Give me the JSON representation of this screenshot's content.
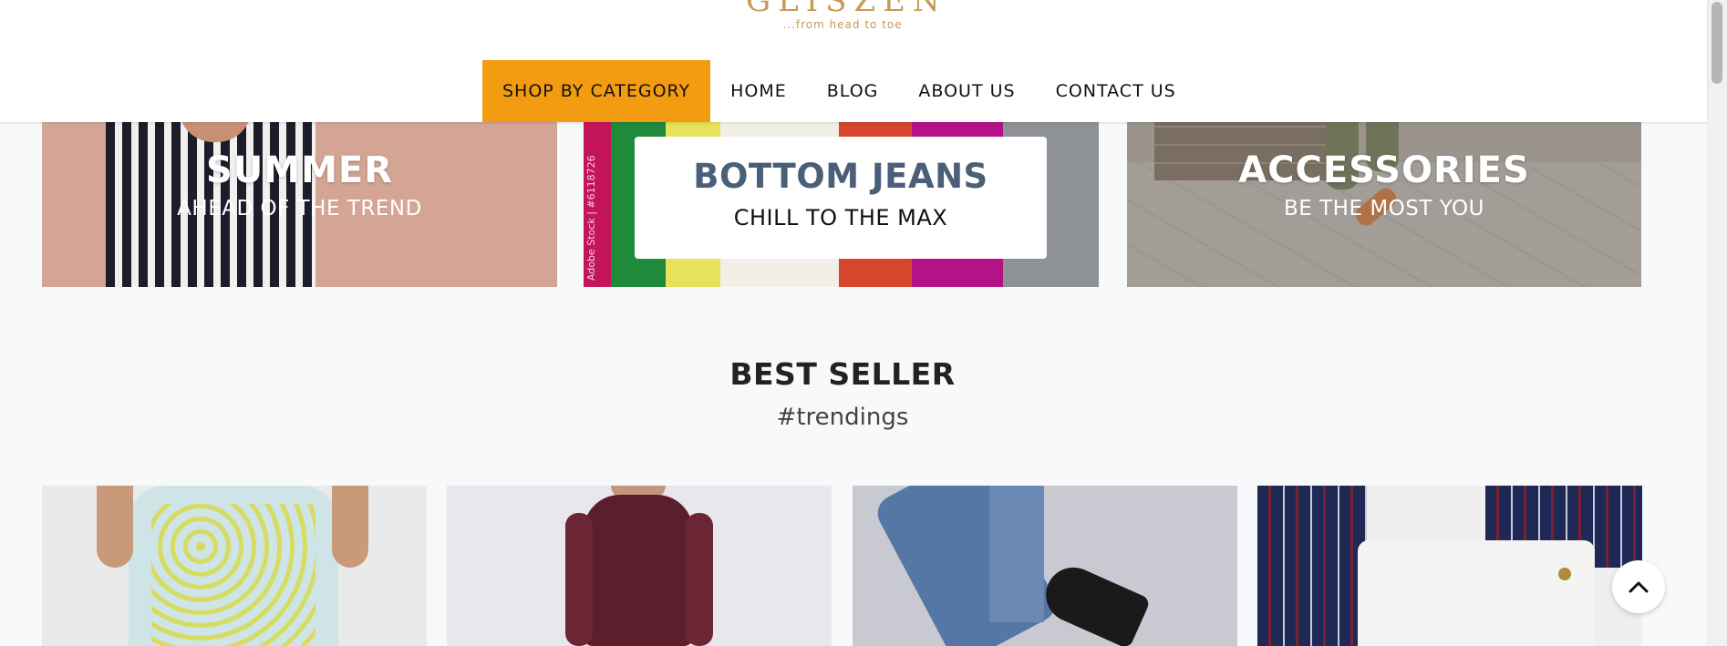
{
  "brand": {
    "name": "GLISZEN",
    "tagline": "...from head to toe"
  },
  "nav": {
    "items": [
      {
        "label": "SHOP BY CATEGORY"
      },
      {
        "label": "HOME"
      },
      {
        "label": "BLOG"
      },
      {
        "label": "ABOUT US"
      },
      {
        "label": "CONTACT US"
      }
    ]
  },
  "banners": {
    "summer": {
      "title": "SUMMER",
      "subtitle": "AHEAD OF THE TREND"
    },
    "jeans": {
      "title": "BOTTOM JEANS",
      "subtitle": "CHILL TO THE MAX",
      "watermark": "Adobe Stock | #6118726"
    },
    "accessories": {
      "title": "ACCESSORIES",
      "subtitle": "BE THE MOST YOU"
    }
  },
  "best_seller": {
    "title": "BEST SELLER",
    "subtitle": "#trendings"
  },
  "colors": {
    "accent": "#f39c12",
    "jeans_title": "#4a5f78",
    "brand_gold": "#c79a55"
  },
  "icons": {
    "back_to_top": "chevron-up-icon"
  }
}
